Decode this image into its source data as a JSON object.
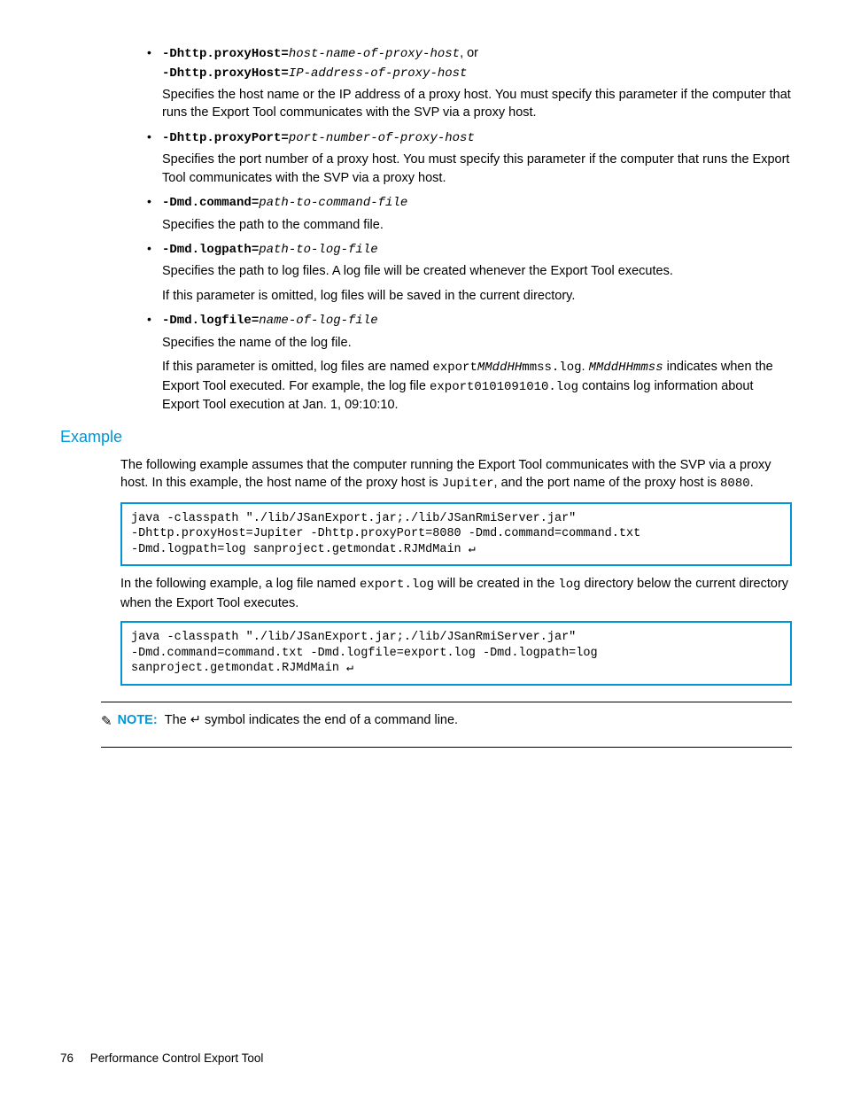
{
  "params": [
    {
      "syntax_html": "<span class='code-bold'>-Dhttp.proxyHost=</span><span class='code-italic'>host-name-of-proxy-host</span>, or<br><span class='code-bold'>-Dhttp.proxyHost=</span><span class='code-italic'>IP-address-of-proxy-host</span>",
      "desc_parts": [
        "Specifies the host name or the IP address of a proxy host. You must specify this parameter if the computer that runs the Export Tool communicates with the SVP via a proxy host."
      ]
    },
    {
      "syntax_html": "<span class='code-bold'>-Dhttp.proxyPort=</span><span class='code-italic'>port-number-of-proxy-host</span>",
      "desc_parts": [
        "Specifies the port number of a proxy host. You must specify this parameter if the computer that runs the Export Tool communicates with the SVP via a proxy host."
      ]
    },
    {
      "syntax_html": "<span class='code-bold'>-Dmd.command=</span><span class='code-italic'>path-to-command-file</span>",
      "desc_parts": [
        "Specifies the path to the command file."
      ]
    },
    {
      "syntax_html": "<span class='code-bold'>-Dmd.logpath=</span><span class='code-italic'>path-to-log-file</span>",
      "desc_parts": [
        "Specifies the path to log files. A log file will be created whenever the Export Tool executes.",
        "If this parameter is omitted, log files will be saved in the current directory."
      ]
    },
    {
      "syntax_html": "<span class='code-bold'>-Dmd.logfile=</span><span class='code-italic'>name-of-log-file</span>",
      "desc_parts": [
        "Specifies the name of the log file."
      ],
      "desc_html": "If this parameter is omitted, log files are named <span class='code-normal'>export</span><span class='code-italic'>MMddHH</span><span class='code-normal'>mmss.log</span>. <span class='code-italic'>MMddHHmmss</span> indicates when the Export Tool executed. For example, the log file <span class='code-normal'>export0101091010.log</span> contains log information about Export Tool execution at Jan. 1, 09:10:10."
    }
  ],
  "example_heading": "Example",
  "example_intro_html": "The following example assumes that the computer running the Export Tool communicates with the SVP via a proxy host. In this example, the host name of the proxy host is <span class='code-normal'>Jupiter</span>, and the port name of the proxy host is <span class='code-normal'>8080</span>.",
  "code_block_1": "java -classpath \"./lib/JSanExport.jar;./lib/JSanRmiServer.jar\"\n-Dhttp.proxyHost=Jupiter -Dhttp.proxyPort=8080 -Dmd.command=command.txt\n-Dmd.logpath=log sanproject.getmondat.RJMdMain ↵",
  "example_mid_html": "In the following example, a log file named <span class='code-normal'>export.log</span> will be created in the <span class='code-normal'>log</span> directory below the current directory when the Export Tool executes.",
  "code_block_2": "java -classpath \"./lib/JSanExport.jar;./lib/JSanRmiServer.jar\"\n-Dmd.command=command.txt -Dmd.logfile=export.log -Dmd.logpath=log\nsanproject.getmondat.RJMdMain ↵",
  "note_label": "NOTE:",
  "note_text_html": "The <span class='enter-sym'>↵</span> symbol indicates the end of a command line.",
  "footer_page": "76",
  "footer_title": "Performance Control Export Tool"
}
